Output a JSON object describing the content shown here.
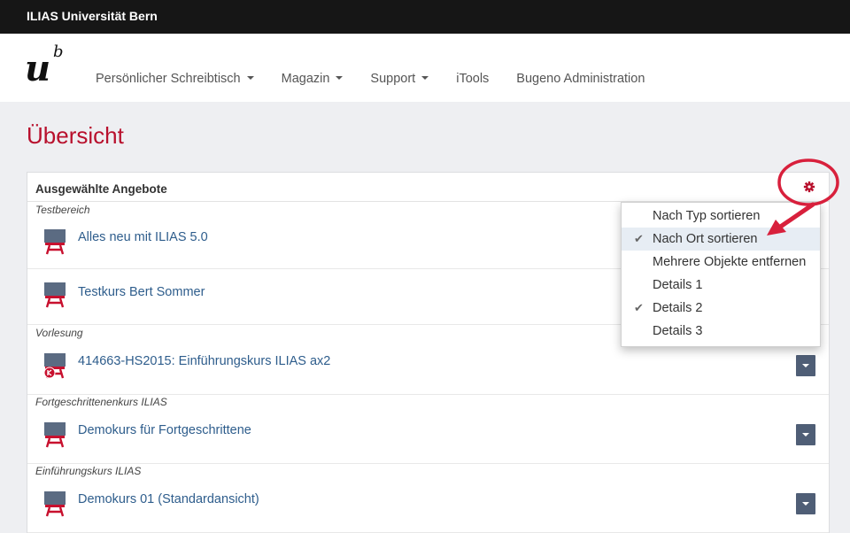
{
  "topbar": {
    "title": "ILIAS Universität Bern"
  },
  "logo": {
    "main": "u",
    "sup": "b"
  },
  "nav": {
    "items": [
      {
        "label": "Persönlicher Schreibtisch",
        "has_caret": true
      },
      {
        "label": "Magazin",
        "has_caret": true
      },
      {
        "label": "Support",
        "has_caret": true
      },
      {
        "label": "iTools",
        "has_caret": false
      },
      {
        "label": "Bugeno Administration",
        "has_caret": false
      }
    ]
  },
  "page": {
    "title": "Übersicht"
  },
  "panel": {
    "title": "Ausgewählte Angebote",
    "groups": [
      {
        "label": "Testbereich",
        "items": [
          {
            "label": "Alles neu mit ILIAS 5.0",
            "offline": false
          },
          {
            "label": "Testkurs Bert Sommer",
            "offline": false
          }
        ]
      },
      {
        "label": "Vorlesung",
        "items": [
          {
            "label": "414663-HS2015: Einführungskurs ILIAS ax2",
            "offline": true
          }
        ]
      },
      {
        "label": "Fortgeschrittenenkurs ILIAS",
        "items": [
          {
            "label": "Demokurs für Fortgeschrittene",
            "offline": false
          }
        ]
      },
      {
        "label": "Einführungskurs ILIAS",
        "items": [
          {
            "label": "Demokurs 01 (Standardansicht)",
            "offline": false
          }
        ]
      }
    ]
  },
  "dropdown": {
    "items": [
      {
        "label": "Nach Typ sortieren",
        "checked": false
      },
      {
        "label": "Nach Ort sortieren",
        "checked": true
      },
      {
        "label": "Mehrere Objekte entfernen",
        "checked": false
      },
      {
        "label": "Details 1",
        "checked": false
      },
      {
        "label": "Details 2",
        "checked": true
      },
      {
        "label": "Details 3",
        "checked": false
      }
    ]
  },
  "colors": {
    "accent": "#b8102d",
    "link": "#2e5d8c",
    "button": "#4f5e76",
    "annotation": "#d8203c"
  },
  "icons": {
    "course": "course-easel-icon",
    "settings": "gear-icon",
    "check": "checkmark-icon"
  }
}
